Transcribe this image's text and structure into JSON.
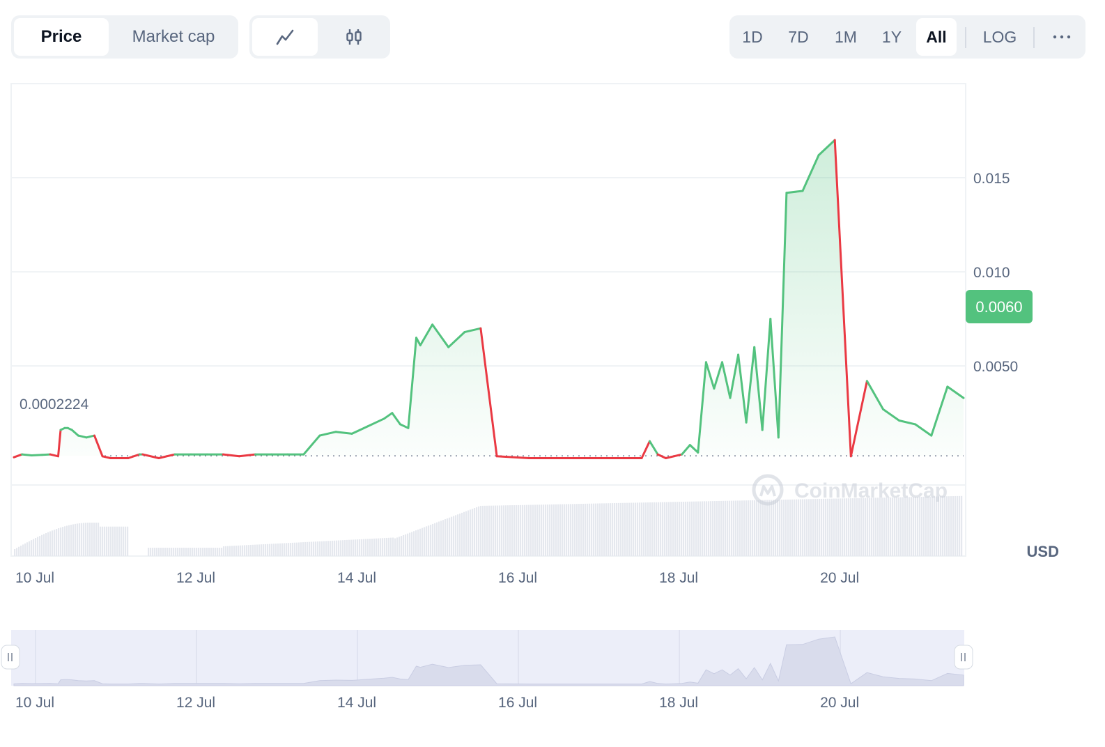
{
  "metric_tabs": [
    {
      "label": "Price",
      "active": true
    },
    {
      "label": "Market cap",
      "active": false
    }
  ],
  "chart_type_buttons": [
    {
      "icon": "line-chart-icon",
      "active": true
    },
    {
      "icon": "candlestick-icon",
      "active": false
    }
  ],
  "range_buttons": [
    {
      "label": "1D",
      "active": false
    },
    {
      "label": "7D",
      "active": false
    },
    {
      "label": "1M",
      "active": false
    },
    {
      "label": "1Y",
      "active": false
    },
    {
      "label": "All",
      "active": true
    },
    {
      "label": "LOG",
      "active": false
    }
  ],
  "more_icon": "more-horizontal-icon",
  "currency_label": "USD",
  "watermark": "CoinMarketCap",
  "colors": {
    "up": "#53c27e",
    "down": "#ea3943",
    "grid": "#eff2f5",
    "text": "#58667e",
    "volume": "#e5e8ee",
    "navigator_bg": "#eceef9",
    "navigator_fill": "#d9dcec"
  },
  "chart_data": {
    "type": "line",
    "series": [
      {
        "x": [
          0,
          0.1,
          0.22,
          0.35,
          0.45,
          0.55,
          0.58,
          0.63,
          0.67,
          0.72,
          0.8,
          0.9,
          1.0,
          1.1,
          1.2,
          1.3,
          1.42,
          1.56,
          1.6,
          1.8,
          2.0,
          2.2,
          2.4,
          2.6,
          2.8,
          3.0,
          3.2,
          3.4,
          3.6,
          3.8,
          4.0,
          4.2,
          4.4,
          4.6,
          4.7,
          4.8,
          4.9,
          5.0,
          5.05,
          5.2,
          5.4,
          5.6,
          5.8,
          6.0,
          6.4,
          6.6,
          6.8,
          7.0,
          7.2,
          7.4,
          7.6,
          7.8,
          7.9,
          8.0,
          8.1,
          8.2,
          8.3,
          8.4,
          8.5,
          8.6,
          8.7,
          8.8,
          8.9,
          9.0,
          9.1,
          9.2,
          9.3,
          9.4,
          9.5,
          9.6,
          9.8,
          10.0,
          10.2,
          10.4,
          10.6,
          10.8,
          11.0,
          11.2,
          11.4,
          11.6,
          11.8
        ],
        "y": [
          0.00015,
          0.0003,
          0.00025,
          0.00028,
          0.0003,
          0.0002,
          0.0016,
          0.0017,
          0.0017,
          0.0016,
          0.0013,
          0.0012,
          0.0013,
          0.0002,
          0.0001,
          0.0001,
          0.0001,
          0.0003,
          0.0003,
          0.0001,
          0.0003,
          0.0003,
          0.0003,
          0.0003,
          0.0002,
          0.0003,
          0.0003,
          0.0003,
          0.0003,
          0.0013,
          0.0015,
          0.0014,
          0.0018,
          0.0022,
          0.0025,
          0.0019,
          0.0017,
          0.0065,
          0.0061,
          0.0072,
          0.006,
          0.0068,
          0.007,
          0.0002,
          0.0001,
          0.0001,
          0.0001,
          0.0001,
          0.0001,
          0.0001,
          0.0001,
          0.0001,
          0.001,
          0.0003,
          0.0001,
          0.0002,
          0.0003,
          0.0008,
          0.0004,
          0.0052,
          0.0038,
          0.0052,
          0.0033,
          0.0056,
          0.002,
          0.006,
          0.0016,
          0.0075,
          0.0012,
          0.0142,
          0.0143,
          0.0162,
          0.017,
          0.0002,
          0.0042,
          0.0027,
          0.0021,
          0.0019,
          0.0013,
          0.0039,
          0.0033
        ],
        "name": "",
        "color": "#53c27e"
      }
    ],
    "x_tick_labels": [
      "10 Jul",
      "12 Jul",
      "14 Jul",
      "16 Jul",
      "18 Jul",
      "20 Jul"
    ],
    "y_tick_labels": [
      "0.015",
      "0.010",
      "0.0050"
    ],
    "reference_line_value": 0.0002224,
    "reference_line_label": "0.0002224",
    "current_price_label": "0.0060",
    "xlabel": "",
    "ylabel": "USD",
    "ylim": [
      -0.0051,
      0.02
    ],
    "grid": true,
    "log_scale": false
  }
}
